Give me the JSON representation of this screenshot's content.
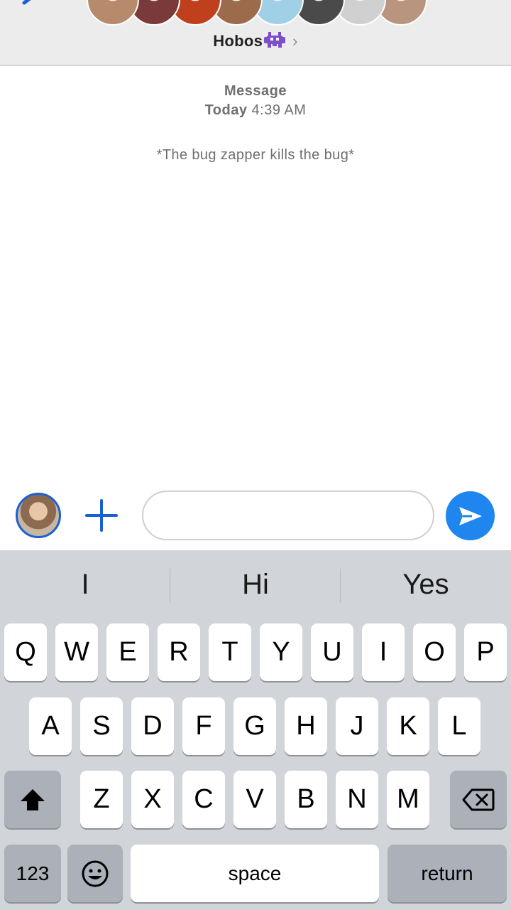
{
  "header": {
    "group_name": "Hobos",
    "chevron": "›",
    "back_icon": "back-chevron-icon",
    "emoji_icon": "alien-monster-emoji-icon",
    "avatar_colors": [
      "#b68a6a",
      "#7a3a3a",
      "#c0401e",
      "#9c6b4b",
      "#9fd0e6",
      "#4a4a4a",
      "#d0d0d0",
      "#b9957f"
    ]
  },
  "messages": {
    "meta_label": "Message",
    "meta_day": "Today",
    "meta_time": "4:39 AM",
    "system_text": "*The bug zapper kills the bug*"
  },
  "composer": {
    "input_value": "",
    "input_placeholder": "",
    "plus_icon": "plus-icon",
    "send_icon": "send-arrow-icon",
    "accent_color": "#1f86f0"
  },
  "keyboard": {
    "suggestions": [
      "I",
      "Hi",
      "Yes"
    ],
    "row1": [
      "Q",
      "W",
      "E",
      "R",
      "T",
      "Y",
      "U",
      "I",
      "O",
      "P"
    ],
    "row2": [
      "A",
      "S",
      "D",
      "F",
      "G",
      "H",
      "J",
      "K",
      "L"
    ],
    "row3": [
      "Z",
      "X",
      "C",
      "V",
      "B",
      "N",
      "M"
    ],
    "numbers_label": "123",
    "space_label": "space",
    "return_label": "return",
    "shift_icon": "shift-arrow-icon",
    "delete_icon": "backspace-icon",
    "emoji_icon": "emoji-face-icon"
  }
}
